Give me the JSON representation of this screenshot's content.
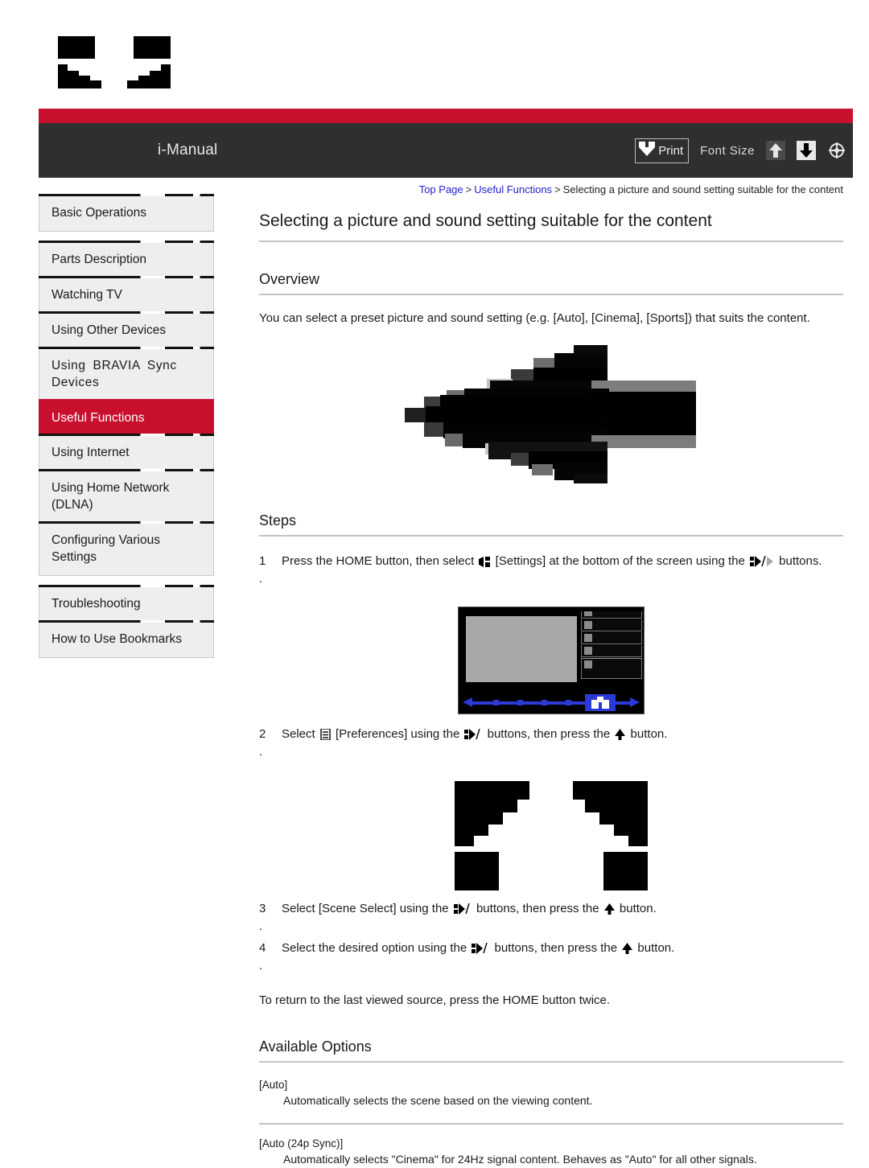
{
  "colors": {
    "accent_red": "#c8102e",
    "header_dark": "#2f2f2f",
    "link_blue": "#2222cc",
    "tv_blue": "#2b39d6",
    "rule_gray": "#c4c4c4"
  },
  "header": {
    "brand": "i-Manual",
    "print_label": "Print",
    "font_size_label": "Font Size",
    "icons": {
      "print": "print-download-icon",
      "font_increase": "font-size-up-arrow-icon",
      "font_decrease": "font-size-down-arrow-icon",
      "font_reset": "font-size-reset-icon"
    }
  },
  "logo": {
    "name": "sony-logo-redacted"
  },
  "sidebar": {
    "groups": [
      {
        "items": [
          {
            "label": "Basic Operations",
            "active": false
          }
        ]
      },
      {
        "items": [
          {
            "label": "Parts Description",
            "active": false
          },
          {
            "label": "Watching TV",
            "active": false
          },
          {
            "label": "Using Other Devices",
            "active": false
          },
          {
            "label": "Using  BRAVIA  Sync Devices",
            "active": false
          },
          {
            "label": "Useful Functions",
            "active": true
          },
          {
            "label": "Using Internet",
            "active": false
          },
          {
            "label": "Using Home Network (DLNA)",
            "active": false
          },
          {
            "label": "Configuring Various Settings",
            "active": false
          }
        ]
      },
      {
        "items": [
          {
            "label": "Troubleshooting",
            "active": false
          },
          {
            "label": "How to Use Bookmarks",
            "active": false
          }
        ]
      }
    ]
  },
  "breadcrumb": {
    "item1": "Top Page",
    "item2": "Useful Functions",
    "current": "Selecting a picture and sound setting suitable for the content",
    "separator": ">"
  },
  "page": {
    "title": "Selecting a picture and sound setting suitable for the content"
  },
  "overview": {
    "heading": "Overview",
    "text": "You can select a preset picture and sound setting (e.g. [Auto], [Cinema], [Sports]) that suits the content.",
    "figure_name": "overview-pixelated-illustration"
  },
  "steps_section": {
    "heading": "Steps",
    "items": [
      {
        "num": "1 .",
        "parts": [
          {
            "t": "text",
            "v": "Press the HOME button, then select "
          },
          {
            "t": "icon",
            "v": "settings-suitcase-icon"
          },
          {
            "t": "text",
            "v": " [Settings] at the bottom of the screen using the "
          },
          {
            "t": "icon",
            "v": "dpad-left-right-icon"
          },
          {
            "t": "text",
            "v": " buttons."
          }
        ],
        "plain": "Press the HOME button, then select [Settings] at the bottom of the screen using the buttons."
      },
      {
        "num": "2 .",
        "parts": [
          {
            "t": "text",
            "v": "Select "
          },
          {
            "t": "icon",
            "v": "preferences-icon"
          },
          {
            "t": "text",
            "v": " [Preferences] using the "
          },
          {
            "t": "icon",
            "v": "dpad-up-down-icon"
          },
          {
            "t": "text",
            "v": "  buttons, then press the "
          },
          {
            "t": "icon",
            "v": "enter-up-arrow-icon"
          },
          {
            "t": "text",
            "v": " button."
          }
        ],
        "plain": "Select [Preferences] using the buttons, then press the button."
      },
      {
        "num": "3 .",
        "parts": [
          {
            "t": "text",
            "v": "Select [Scene Select] using the "
          },
          {
            "t": "icon",
            "v": "dpad-up-down-icon"
          },
          {
            "t": "text",
            "v": "  buttons, then press the "
          },
          {
            "t": "icon",
            "v": "enter-up-arrow-icon"
          },
          {
            "t": "text",
            "v": " button."
          }
        ],
        "plain": "Select [Scene Select] using the buttons, then press the button."
      },
      {
        "num": "4 .",
        "parts": [
          {
            "t": "text",
            "v": "Select the desired option using the "
          },
          {
            "t": "icon",
            "v": "dpad-up-down-icon"
          },
          {
            "t": "text",
            "v": "  buttons, then press the "
          },
          {
            "t": "icon",
            "v": "enter-up-arrow-icon"
          },
          {
            "t": "text",
            "v": " button."
          }
        ],
        "plain": "Select the desired option using the buttons, then press the button."
      }
    ],
    "note": "To return to the last viewed source, press the HOME button twice.",
    "tv_figure_name": "tv-home-screen-mockup",
    "redacted_figure_name": "redacted-black-blocks-illustration"
  },
  "available_options": {
    "heading": "Available Options",
    "options": [
      {
        "name": "[Auto]",
        "description": "Automatically selects the scene based on the viewing content."
      },
      {
        "name": "[Auto (24p Sync)]",
        "description": "Automatically selects \"Cinema\" for 24Hz signal content. Behaves as \"Auto\" for all other signals."
      }
    ]
  }
}
